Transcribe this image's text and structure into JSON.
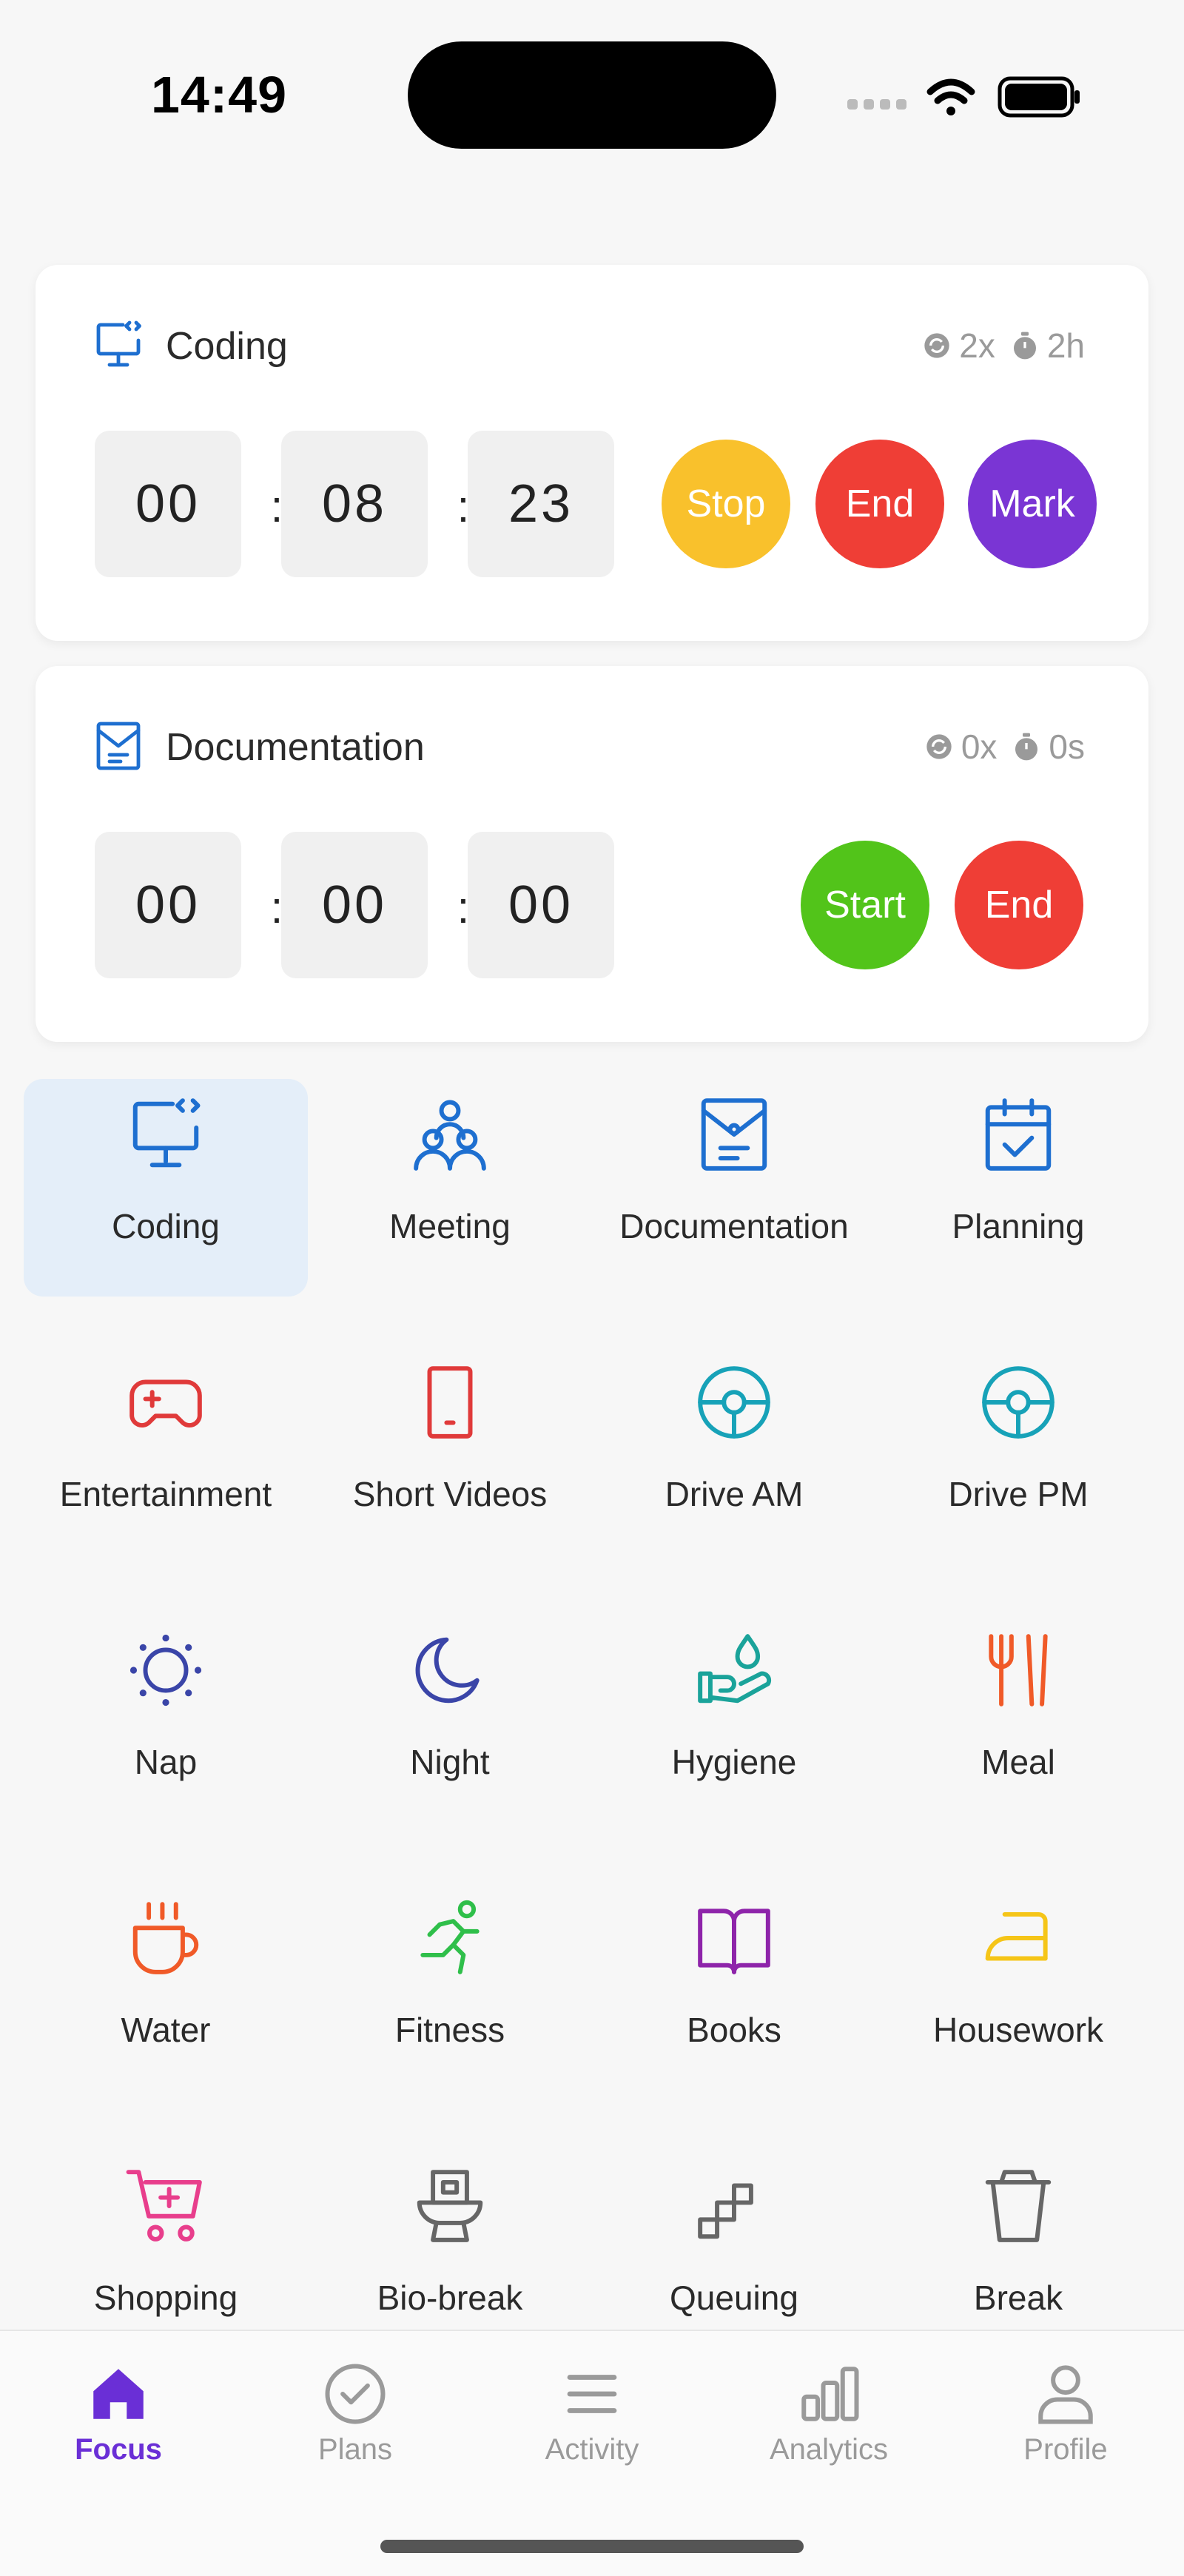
{
  "status_bar": {
    "time": "14:49"
  },
  "colors": {
    "accent": "#6a2fd6",
    "stop": "#f9c12c",
    "end": "#ef3e36",
    "mark": "#7a35d4",
    "start": "#52c41a",
    "blue": "#1e6fd0",
    "selected_bg": "#e4eef9"
  },
  "timers": [
    {
      "title": "Coding",
      "icon": "monitor-code-icon",
      "count": "2x",
      "duration": "2h",
      "hours": "00",
      "minutes": "08",
      "seconds": "23",
      "buttons": [
        "Stop",
        "End",
        "Mark"
      ]
    },
    {
      "title": "Documentation",
      "icon": "envelope-doc-icon",
      "count": "0x",
      "duration": "0s",
      "hours": "00",
      "minutes": "00",
      "seconds": "00",
      "buttons": [
        "Start",
        "End"
      ]
    }
  ],
  "activities": [
    {
      "label": "Coding",
      "icon": "monitor-code-icon",
      "color": "#1e6fd0",
      "selected": true
    },
    {
      "label": "Meeting",
      "icon": "people-icon",
      "color": "#1e6fd0"
    },
    {
      "label": "Documentation",
      "icon": "envelope-doc-icon",
      "color": "#1e6fd0"
    },
    {
      "label": "Planning",
      "icon": "calendar-check-icon",
      "color": "#1e6fd0"
    },
    {
      "label": "Entertainment",
      "icon": "gamepad-icon",
      "color": "#e03a3a"
    },
    {
      "label": "Short Videos",
      "icon": "phone-icon",
      "color": "#e03a3a"
    },
    {
      "label": "Drive AM",
      "icon": "steering-wheel-icon",
      "color": "#17a2b8"
    },
    {
      "label": "Drive PM",
      "icon": "steering-wheel-icon",
      "color": "#17a2b8"
    },
    {
      "label": "Nap",
      "icon": "sun-icon",
      "color": "#3a45a8"
    },
    {
      "label": "Night",
      "icon": "moon-icon",
      "color": "#3a45a8"
    },
    {
      "label": "Hygiene",
      "icon": "hand-drop-icon",
      "color": "#1aa39a"
    },
    {
      "label": "Meal",
      "icon": "fork-chopsticks-icon",
      "color": "#f05a28"
    },
    {
      "label": "Water",
      "icon": "cup-icon",
      "color": "#f05a28"
    },
    {
      "label": "Fitness",
      "icon": "running-icon",
      "color": "#2fbf4a"
    },
    {
      "label": "Books",
      "icon": "book-icon",
      "color": "#8e24aa"
    },
    {
      "label": "Housework",
      "icon": "iron-icon",
      "color": "#f5c518"
    },
    {
      "label": "Shopping",
      "icon": "cart-icon",
      "color": "#e83e8c"
    },
    {
      "label": "Bio-break",
      "icon": "toilet-icon",
      "color": "#666666"
    },
    {
      "label": "Queuing",
      "icon": "stairs-icon",
      "color": "#666666"
    },
    {
      "label": "Break",
      "icon": "trash-cup-icon",
      "color": "#666666"
    }
  ],
  "tabs": [
    {
      "label": "Focus",
      "icon": "home-icon",
      "active": true
    },
    {
      "label": "Plans",
      "icon": "check-circle-icon"
    },
    {
      "label": "Activity",
      "icon": "menu-icon"
    },
    {
      "label": "Analytics",
      "icon": "bar-chart-icon"
    },
    {
      "label": "Profile",
      "icon": "user-icon"
    }
  ]
}
